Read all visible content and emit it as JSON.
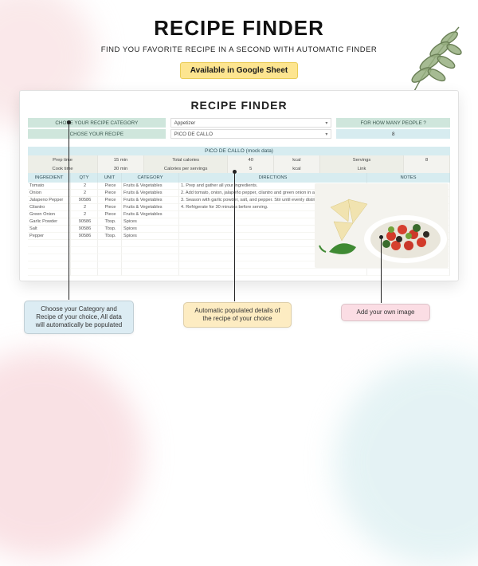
{
  "hero": {
    "title": "RECIPE FINDER",
    "subtitle": "FIND YOU FAVORITE RECIPE IN A SECOND WITH AUTOMATIC FINDER",
    "badge": "Available in Google Sheet"
  },
  "panel": {
    "title": "RECIPE FINDER",
    "selectors": {
      "category_label": "CHOSE YOUR RECIPE CATEGORY",
      "recipe_label": "CHOSE YOUR RECIPE",
      "category_value": "Appetizer",
      "recipe_value": "PICO DE CALLO",
      "people_label": "FOR HOW MANY PEOPLE ?",
      "people_value": "8"
    },
    "recipe_bar": "PICO DE CALLO (mock data)",
    "meta": {
      "prep_label": "Prep time",
      "prep_val": "15 min",
      "cook_label": "Cook time",
      "cook_val": "30 min",
      "totcal_label": "Total calories",
      "totcal_val": "40",
      "totcal_unit": "kcal",
      "perserv_label": "Calories per servings",
      "perserv_val": "5",
      "perserv_unit": "kcal",
      "serv_label": "Servings",
      "serv_link": "Link",
      "serv_val": "8"
    },
    "columns": {
      "ingredient": "INGREDIENT",
      "qty": "QTY",
      "unit": "UNIT",
      "category": "CATEGORY",
      "directions": "DIRECTIONS",
      "notes": "NOTES"
    },
    "rows": [
      {
        "ing": "Tomato",
        "qty": "2",
        "unit": "Piece",
        "cat": "Fruits & Vegetables",
        "dir": "1. Prep and gather all your ingredients."
      },
      {
        "ing": "Onion",
        "qty": "2",
        "unit": "Piece",
        "cat": "Fruits & Vegetables",
        "dir": "2. Add tomato, onion, jalapeño pepper, cilantro and green onion in a medium bowl."
      },
      {
        "ing": "Jalapeno Pepper",
        "qty": "90586",
        "unit": "Piece",
        "cat": "Fruits & Vegetables",
        "dir": "3. Season with garlic powder, salt, and pepper. Stir until evenly distributed."
      },
      {
        "ing": "Cilantro",
        "qty": "2",
        "unit": "Piece",
        "cat": "Fruits & Vegetables",
        "dir": "4. Refrigerate for 30 minutes before serving."
      },
      {
        "ing": "Green Onion",
        "qty": "2",
        "unit": "Piece",
        "cat": "Fruits & Vegetables",
        "dir": ""
      },
      {
        "ing": "Garlic Powder",
        "qty": "90586",
        "unit": "Tbsp.",
        "cat": "Spices",
        "dir": ""
      },
      {
        "ing": "Salt",
        "qty": "90586",
        "unit": "Tbsp.",
        "cat": "Spices",
        "dir": ""
      },
      {
        "ing": "Pepper",
        "qty": "90586",
        "unit": "Tbsp.",
        "cat": "Spices",
        "dir": ""
      }
    ]
  },
  "callouts": {
    "left": "Choose your Category and Recipe of your choice, All data will automatically be populated",
    "mid": "Automatic populated details of the recipe of your choice",
    "right": "Add your own image"
  },
  "colors": {
    "mint": "#cfe6dc",
    "aqua": "#d7ecf0",
    "badge": "#fde590"
  }
}
